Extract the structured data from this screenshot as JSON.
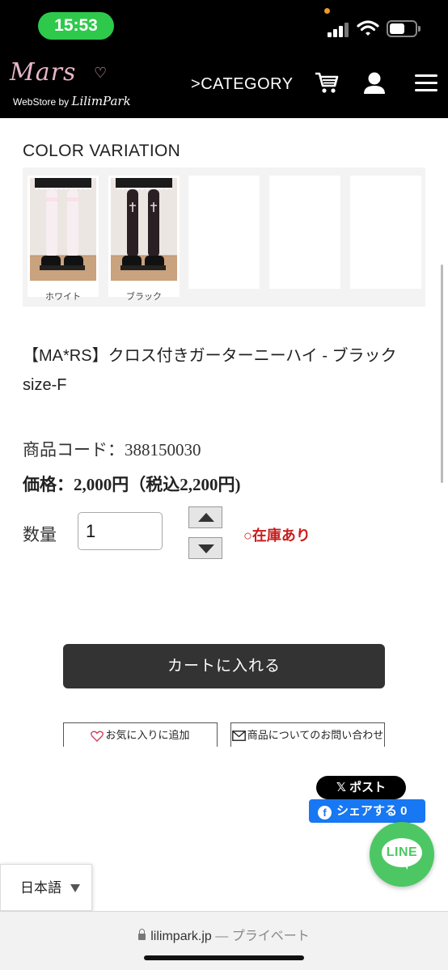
{
  "status_bar": {
    "time": "15:53"
  },
  "header": {
    "logo": {
      "main": "Mars",
      "sub_prefix": "WebStore by ",
      "sub_brand": "LilimPark"
    },
    "category_label": "CATEGORY",
    "icons": [
      "cart-icon",
      "user-icon",
      "menu-icon"
    ]
  },
  "color_variation": {
    "title": "COLOR VARIATION",
    "items": [
      {
        "caption": "ホワイト",
        "stocking_color": "#f7eef1"
      },
      {
        "caption": "ブラック",
        "stocking_color": "#2a1f22"
      }
    ]
  },
  "product": {
    "title": "【MA*RS】クロス付きガーターニーハイ - ブラック size-F",
    "code": "商品コード：388150030",
    "price": "価格：2,000円（税込2,200円)",
    "quantity_label": "数量",
    "quantity_value": "1",
    "stock_status": "○在庫あり"
  },
  "actions": {
    "add_to_cart": "カートに入れる",
    "favorite": "お気に入りに追加",
    "inquiry": "商品についてのお問い合わせ"
  },
  "social": {
    "x_post": "ポスト",
    "fb_share": "シェアする 0",
    "line": "LINE"
  },
  "language": {
    "selected": "日本語"
  },
  "browser": {
    "domain": "lilimpark.jp",
    "mode": "— プライベート"
  },
  "colors": {
    "header_bg": "#000000",
    "cart_button": "#333333",
    "stock_red": "#c81e1e",
    "line_green": "#4cc764",
    "fb_blue": "#1877f2",
    "logo_pink": "#e8b4c8"
  }
}
